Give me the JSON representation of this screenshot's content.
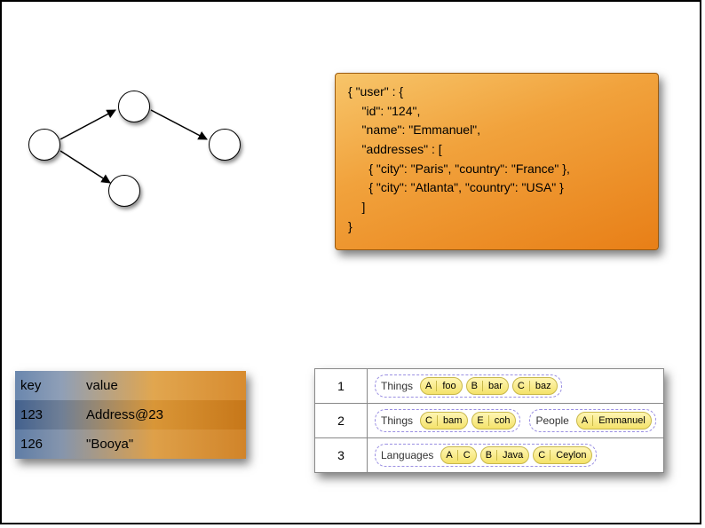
{
  "json_block": "{ \"user\" : {\n    \"id\": \"124\",\n    \"name\": \"Emmanuel\",\n    \"addresses\" : [\n      { \"city\": \"Paris\", \"country\": \"France\" },\n      { \"city\": \"Atlanta\", \"country\": \"USA\" }\n    ]\n}",
  "kv": {
    "head_key": "key",
    "head_val": "value",
    "r1_key": "123",
    "r1_val": "Address@23",
    "r2_key": "126",
    "r2_val": "\"Booya\""
  },
  "cf": {
    "row1": {
      "id": "1",
      "fam": "Things",
      "c1k": "A",
      "c1v": "foo",
      "c2k": "B",
      "c2v": "bar",
      "c3k": "C",
      "c3v": "baz"
    },
    "row2": {
      "id": "2",
      "fam1": "Things",
      "c1k": "C",
      "c1v": "bam",
      "c2k": "E",
      "c2v": "coh",
      "fam2": "People",
      "c3k": "A",
      "c3v": "Emmanuel"
    },
    "row3": {
      "id": "3",
      "fam": "Languages",
      "c1k": "A",
      "c1v": "C",
      "c2k": "B",
      "c2v": "Java",
      "c3k": "C",
      "c3v": "Ceylon"
    }
  }
}
